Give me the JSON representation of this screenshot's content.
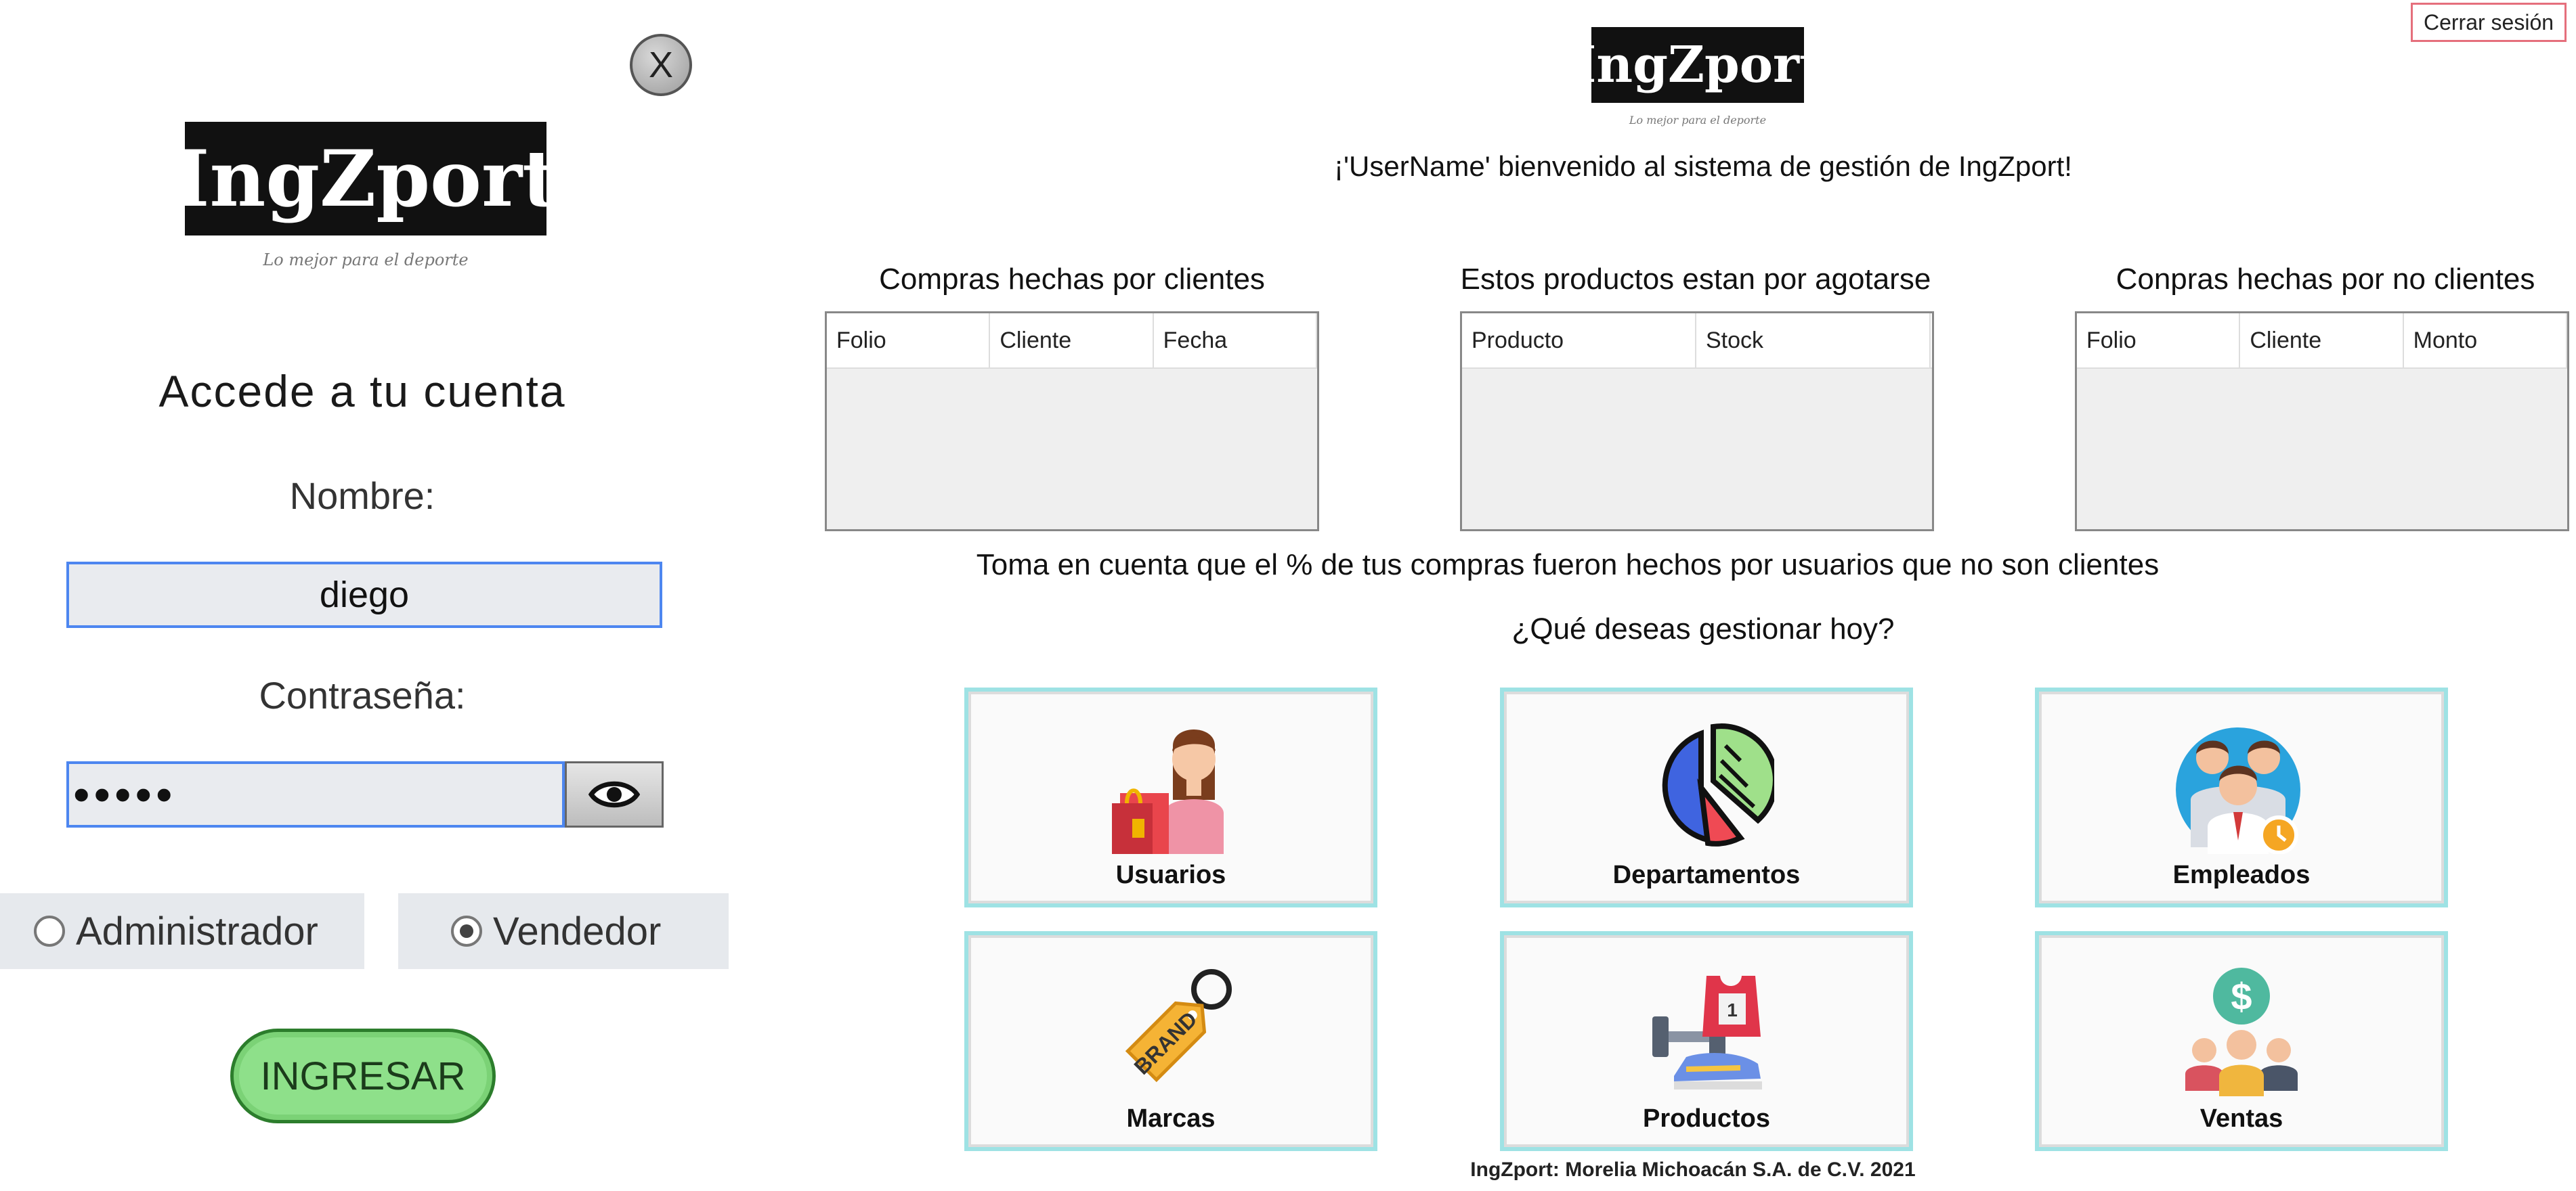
{
  "login": {
    "close_label": "X",
    "logo_text": "IngZport",
    "tagline": "Lo mejor para el deporte",
    "title": "Accede a tu cuenta",
    "name_label": "Nombre:",
    "name_value": "diego",
    "password_label": "Contraseña:",
    "password_value": "12345",
    "roles": [
      {
        "label": "Administrador",
        "selected": false
      },
      {
        "label": "Vendedor",
        "selected": true
      }
    ],
    "submit_label": "INGRESAR"
  },
  "header": {
    "logout_label": "Cerrar sesión",
    "logo_text": "IngZport",
    "tagline": "Lo mejor para el deporte",
    "welcome": "¡'UserName' bienvenido al sistema de gestión de IngZport!"
  },
  "tables": [
    {
      "title": "Compras hechas por clientes",
      "columns": [
        "Folio",
        "Cliente",
        "Fecha"
      ]
    },
    {
      "title": "Estos productos estan por agotarse",
      "columns": [
        "Producto",
        "Stock"
      ]
    },
    {
      "title": "Conpras hechas por no clientes",
      "columns": [
        "Folio",
        "Cliente",
        "Monto"
      ]
    }
  ],
  "note": "Toma en cuenta que el % de tus compras fueron hechos por usuarios que no son clientes",
  "question": "¿Qué deseas gestionar hoy?",
  "modules": [
    {
      "label": "Usuarios",
      "icon": "shopper-icon"
    },
    {
      "label": "Departamentos",
      "icon": "pie-chart-icon"
    },
    {
      "label": "Empleados",
      "icon": "employees-icon"
    },
    {
      "label": "Marcas",
      "icon": "brand-tag-icon",
      "icon_text": "BRAND"
    },
    {
      "label": "Productos",
      "icon": "sports-products-icon",
      "icon_text": "1"
    },
    {
      "label": "Ventas",
      "icon": "sales-icon"
    }
  ],
  "footer": "IngZport: Morelia Michoacán S.A. de C.V. 2021"
}
